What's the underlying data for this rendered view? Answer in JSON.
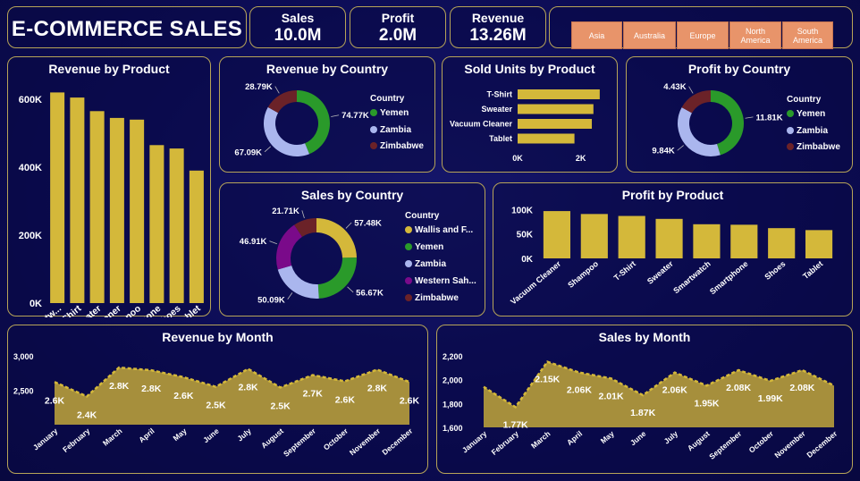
{
  "header": {
    "title": "E-COMMERCE SALES"
  },
  "kpis": [
    {
      "label": "Sales",
      "value": "10.0M"
    },
    {
      "label": "Profit",
      "value": "2.0M"
    },
    {
      "label": "Revenue",
      "value": "13.26M"
    }
  ],
  "region_slicer": [
    "Asia",
    "Australia",
    "Europe",
    "North America",
    "South America"
  ],
  "colors": {
    "bar": "#d4b83a",
    "area": "#a68f3c",
    "line": "#d4b83a",
    "yemen": "#2a9a2a",
    "zambia": "#aab6ee",
    "zimbabwe": "#6b2228",
    "wallis": "#d4b83a",
    "western_sahara": "#7a0a8a",
    "slicer": "#e8946a",
    "border": "#b7a458"
  },
  "revenue_by_product": {
    "title": "Revenue by Product",
    "chart_data": {
      "type": "bar",
      "categories": [
        "Smartwatch",
        "T-Shirt",
        "Sweater",
        "Vacuum Cleaner",
        "Shampoo",
        "Smartphone",
        "Shoes",
        "Tablet"
      ],
      "tick_labels": [
        "Smartw...",
        "T-Shirt",
        "Sweater",
        "Vacuum Cleaner",
        "Shampoo",
        "Smartphone",
        "Shoes",
        "Tablet"
      ],
      "values": [
        620000,
        605000,
        565000,
        545000,
        540000,
        465000,
        455000,
        390000
      ],
      "ylim": [
        0,
        650000
      ],
      "yticks": [
        0,
        200000,
        400000,
        600000
      ],
      "ytick_labels": [
        "0K",
        "200K",
        "400K",
        "600K"
      ]
    }
  },
  "revenue_by_country": {
    "title": "Revenue by Country",
    "legend_title": "Country",
    "chart_data": {
      "type": "pie",
      "labels": [
        "Yemen",
        "Zambia",
        "Zimbabwe"
      ],
      "values": [
        74.77,
        67.09,
        28.79
      ],
      "value_labels": [
        "74.77K",
        "67.09K",
        "28.79K"
      ]
    }
  },
  "sold_units_by_product": {
    "title": "Sold Units by Product",
    "chart_data": {
      "type": "bar",
      "orientation": "horizontal",
      "categories": [
        "T-Shirt",
        "Sweater",
        "Vacuum Cleaner",
        "Tablet"
      ],
      "values": [
        2600,
        2400,
        2350,
        1800
      ],
      "xlim": [
        0,
        3000
      ],
      "xticks": [
        0,
        2000
      ],
      "xtick_labels": [
        "0K",
        "2K"
      ]
    }
  },
  "profit_by_country": {
    "title": "Profit by Country",
    "legend_title": "Country",
    "chart_data": {
      "type": "pie",
      "labels": [
        "Yemen",
        "Zambia",
        "Zimbabwe"
      ],
      "values": [
        11.81,
        9.84,
        4.43
      ],
      "value_labels": [
        "11.81K",
        "9.84K",
        "4.43K"
      ]
    }
  },
  "sales_by_country": {
    "title": "Sales by Country",
    "legend_title": "Country",
    "chart_data": {
      "type": "pie",
      "labels": [
        "Wallis and F...",
        "Yemen",
        "Zambia",
        "Western Sah...",
        "Zimbabwe"
      ],
      "values": [
        57.48,
        56.67,
        50.09,
        46.91,
        21.71
      ],
      "value_labels": [
        "57.48K",
        "56.67K",
        "50.09K",
        "46.91K",
        "21.71K"
      ]
    }
  },
  "profit_by_product": {
    "title": "Profit by Product",
    "chart_data": {
      "type": "bar",
      "categories": [
        "Vacuum Cleaner",
        "Shampoo",
        "T-Shirt",
        "Sweater",
        "Smartwatch",
        "Smartphone",
        "Shoes",
        "Tablet"
      ],
      "values": [
        97000,
        91000,
        87000,
        81000,
        70000,
        69000,
        62000,
        58000
      ],
      "ylim": [
        0,
        110000
      ],
      "yticks": [
        0,
        50000,
        100000
      ],
      "ytick_labels": [
        "0K",
        "50K",
        "100K"
      ]
    }
  },
  "revenue_by_month": {
    "title": "Revenue by Month",
    "chart_data": {
      "type": "area",
      "categories": [
        "January",
        "February",
        "March",
        "April",
        "May",
        "June",
        "July",
        "August",
        "September",
        "October",
        "November",
        "December"
      ],
      "values": [
        2620,
        2410,
        2830,
        2790,
        2690,
        2550,
        2810,
        2540,
        2720,
        2630,
        2800,
        2620
      ],
      "value_labels": [
        "2.6K",
        "2.4K",
        "2.8K",
        "2.8K",
        "2.6K",
        "2.5K",
        "2.8K",
        "2.5K",
        "2.7K",
        "2.6K",
        "2.8K",
        "2.6K"
      ],
      "ylim": [
        2000,
        3000
      ],
      "yticks": [
        2500,
        3000
      ],
      "ytick_labels": [
        "2,500",
        "3,000"
      ]
    }
  },
  "sales_by_month": {
    "title": "Sales by Month",
    "chart_data": {
      "type": "area",
      "categories": [
        "January",
        "February",
        "March",
        "April",
        "May",
        "June",
        "July",
        "August",
        "September",
        "October",
        "November",
        "December"
      ],
      "values": [
        1940,
        1770,
        2150,
        2060,
        2010,
        1870,
        2060,
        1950,
        2080,
        1990,
        2080,
        1950
      ],
      "value_labels": [
        "",
        "1.77K",
        "2.15K",
        "2.06K",
        "2.01K",
        "1.87K",
        "2.06K",
        "1.95K",
        "2.08K",
        "1.99K",
        "2.08K",
        ""
      ],
      "ylim": [
        1600,
        2200
      ],
      "yticks": [
        1600,
        1800,
        2000,
        2200
      ],
      "ytick_labels": [
        "1,600",
        "1,800",
        "2,000",
        "2,200"
      ]
    }
  }
}
